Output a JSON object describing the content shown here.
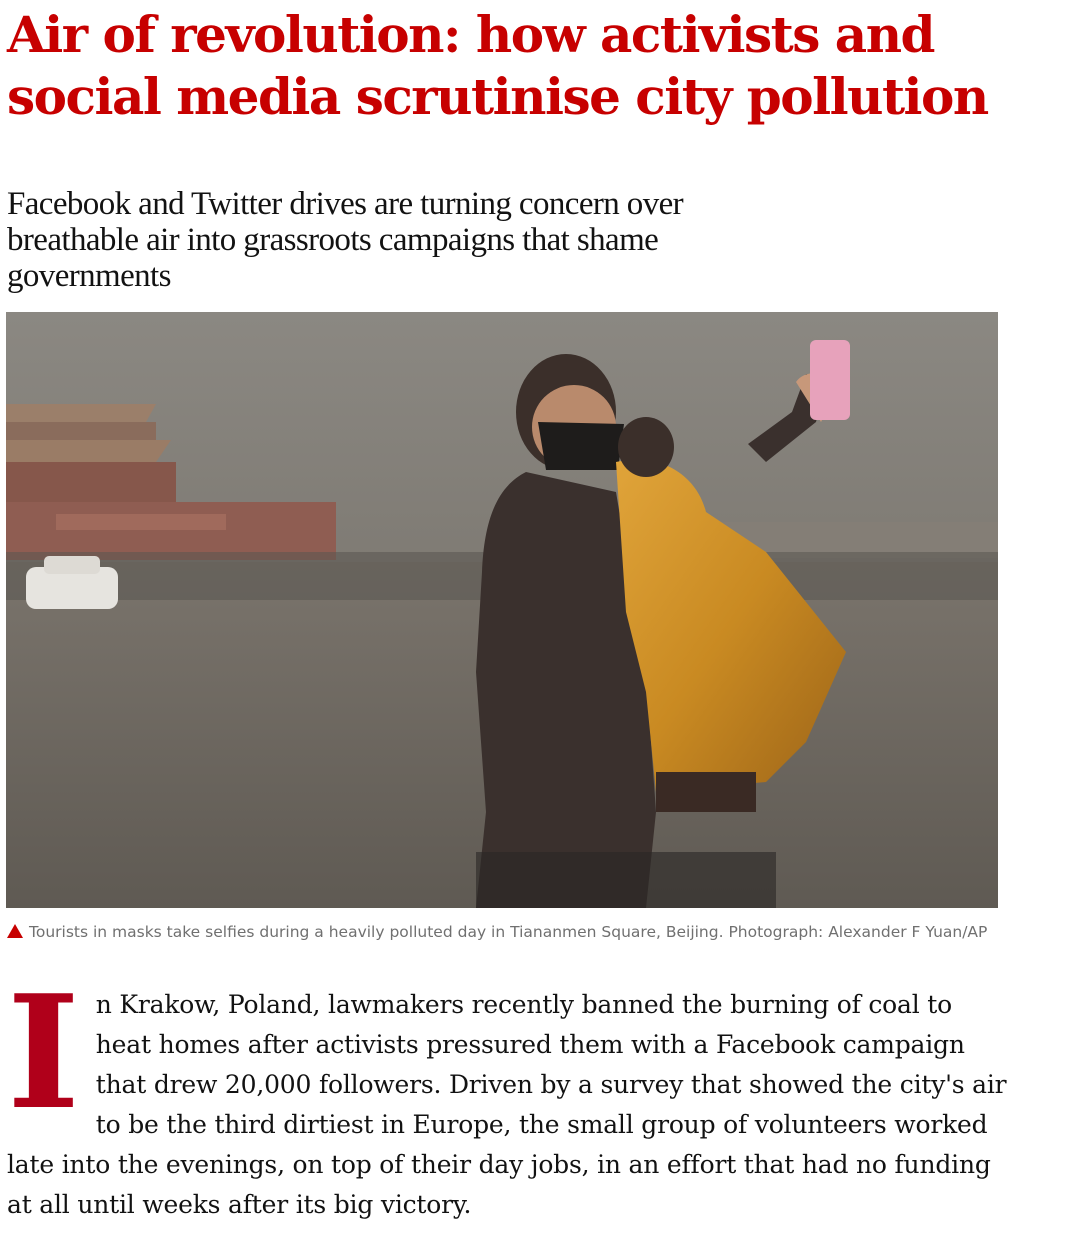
{
  "article": {
    "headline": "Air of revolution: how activists and social media scrutinise city pollution",
    "standfirst": "Facebook and Twitter drives are turning concern over breathable air into grassroots campaigns that shame governments",
    "image": {
      "icon": "caption-triangle-icon",
      "caption": "Tourists in masks take selfies during a heavily polluted day in Tiananmen Square, Beijing. Photograph: Alexander F Yuan/AP"
    },
    "body": {
      "dropcap": "I",
      "text": "n Krakow, Poland, lawmakers recently banned the burning of coal to heat homes after activists pressured them with a Facebook campaign that drew 20,000 followers. Driven by a survey that showed the city's air to be the third dirtiest in Europe, the small group of volunteers worked late into the evenings, on top of their day jobs, in an effort that had no funding at all until weeks after its big victory."
    },
    "colors": {
      "headline": "#c70000",
      "dropcap": "#b0001a",
      "caption": "#707070",
      "text": "#121212"
    }
  }
}
